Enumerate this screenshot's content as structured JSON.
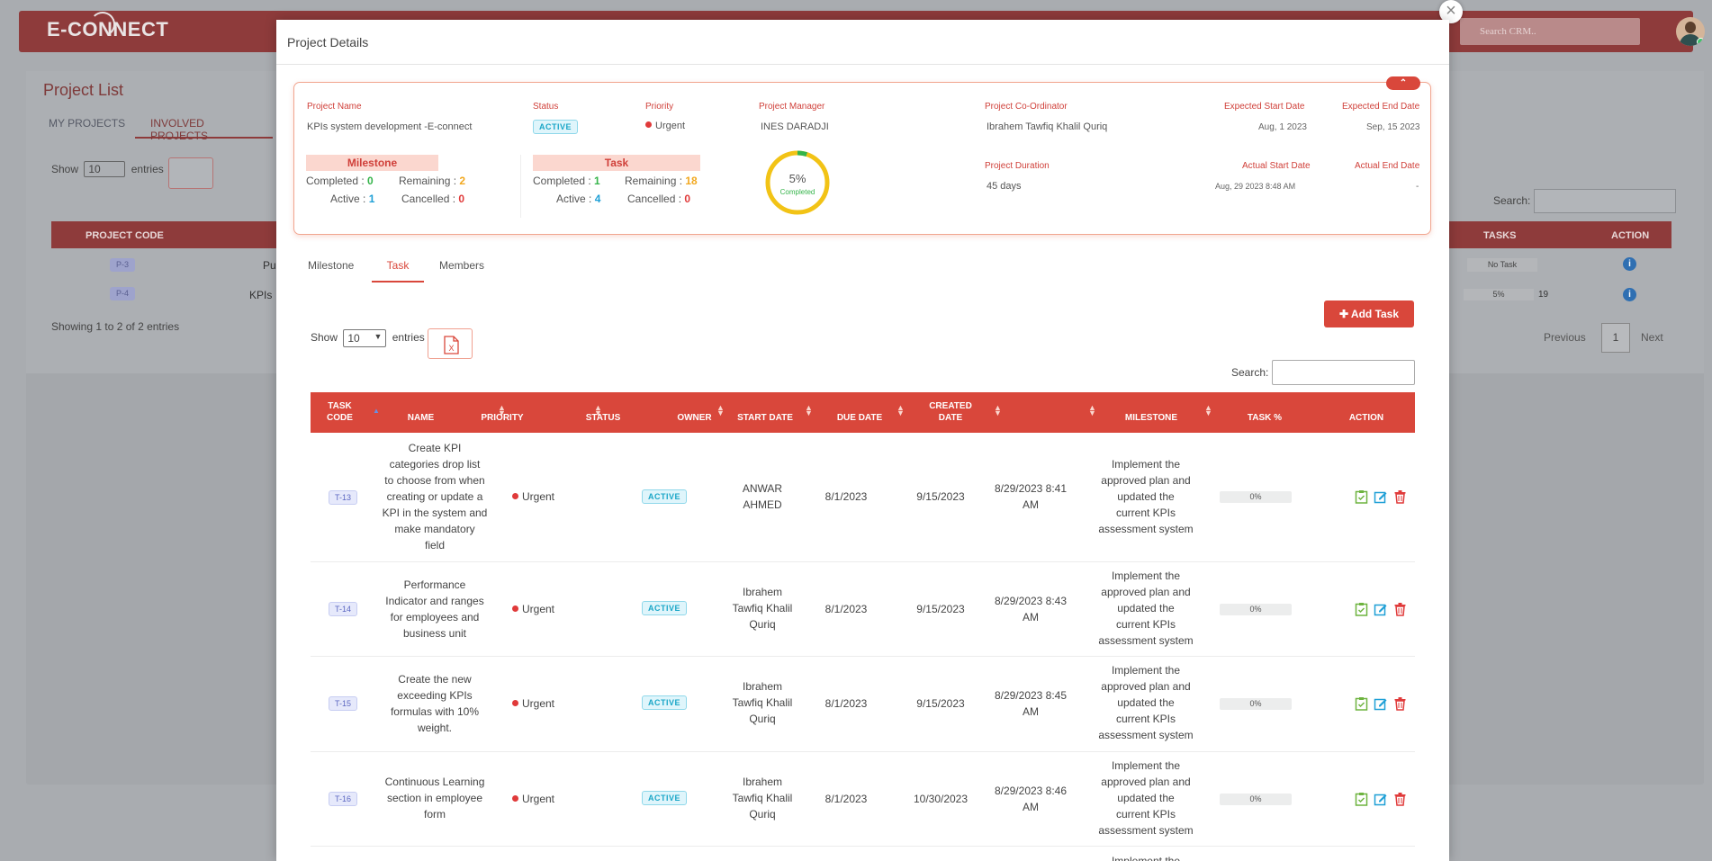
{
  "app": {
    "logo": "E-CONNECT",
    "search_placeholder": "Search CRM.."
  },
  "project_list": {
    "title": "Project List",
    "tabs": [
      "MY PROJECTS",
      "INVOLVED PROJECTS"
    ],
    "show_label": "Show",
    "entries_value": "10",
    "entries_label": "entries",
    "search_label": "Search:",
    "columns": [
      "PROJECT CODE",
      "TASKS",
      "ACTION"
    ],
    "rows": [
      {
        "code": "P-3",
        "name": "Pu",
        "tasks": "No Task"
      },
      {
        "code": "P-4",
        "name": "KPIs",
        "progress": "5%",
        "count": "19"
      }
    ],
    "showing": "Showing 1 to 2 of 2 entries",
    "pagination": {
      "previous": "Previous",
      "page": "1",
      "next": "Next"
    }
  },
  "modal": {
    "title": "Project Details",
    "close": "×",
    "summary": {
      "project_name_label": "Project Name",
      "project_name": "KPIs system development -E-connect",
      "status_label": "Status",
      "status": "ACTIVE",
      "priority_label": "Priority",
      "priority": "Urgent",
      "manager_label": "Project Manager",
      "manager": "INES DARADJI",
      "coordinator_label": "Project Co-Ordinator",
      "coordinator": "Ibrahem Tawfiq Khalil Quriq",
      "exp_start_label": "Expected Start Date",
      "exp_start": "Aug, 1 2023",
      "exp_end_label": "Expected End Date",
      "exp_end": "Sep, 15 2023",
      "duration_label": "Project Duration",
      "duration": "45 days",
      "act_start_label": "Actual Start Date",
      "act_start": "Aug, 29 2023 8:48 AM",
      "act_end_label": "Actual End Date",
      "act_end": "-",
      "milestone": {
        "title": "Milestone",
        "completed_label": "Completed :",
        "completed": "0",
        "remaining_label": "Remaining :",
        "remaining": "2",
        "active_label": "Active :",
        "active": "1",
        "cancelled_label": "Cancelled :",
        "cancelled": "0"
      },
      "task": {
        "title": "Task",
        "completed_label": "Completed :",
        "completed": "1",
        "remaining_label": "Remaining :",
        "remaining": "18",
        "active_label": "Active :",
        "active": "4",
        "cancelled_label": "Cancelled :",
        "cancelled": "0"
      },
      "progress_pct": "5%",
      "progress_value": 0.05,
      "progress_label": "Completed"
    },
    "tabs": [
      "Milestone",
      "Task",
      "Members"
    ],
    "active_tab": "Task",
    "add_task_label": "Add Task",
    "show_label": "Show",
    "entries_value": "10",
    "entries_label": "entries",
    "search_label": "Search:",
    "columns": {
      "task_code": [
        "TASK",
        "CODE"
      ],
      "name": "NAME",
      "priority": "PRIORITY",
      "status": "STATUS",
      "owner": "OWNER",
      "start_date": "START DATE",
      "due_date": "DUE DATE",
      "created_date": [
        "CREATED",
        "DATE"
      ],
      "milestone": "MILESTONE",
      "task_pct": "TASK %",
      "action": "ACTION"
    },
    "tasks": [
      {
        "code": "T-13",
        "name": [
          "Create KPI",
          "categories drop list",
          "to choose from when",
          "creating or update a",
          "KPI in the system and",
          "make mandatory",
          "field"
        ],
        "priority": "Urgent",
        "status": "ACTIVE",
        "owner": [
          "ANWAR",
          "AHMED"
        ],
        "start": "8/1/2023",
        "due": "9/15/2023",
        "created": [
          "8/29/2023 8:41",
          "AM"
        ],
        "milestone": [
          "Implement the",
          "approved plan and",
          "updated the",
          "current KPIs",
          "assessment system"
        ],
        "pct": "0%"
      },
      {
        "code": "T-14",
        "name": [
          "Performance",
          "Indicator and ranges",
          "for employees and",
          "business unit"
        ],
        "priority": "Urgent",
        "status": "ACTIVE",
        "owner": [
          "Ibrahem",
          "Tawfiq Khalil",
          "Quriq"
        ],
        "start": "8/1/2023",
        "due": "9/15/2023",
        "created": [
          "8/29/2023 8:43",
          "AM"
        ],
        "milestone": [
          "Implement the",
          "approved plan and",
          "updated the",
          "current KPIs",
          "assessment system"
        ],
        "pct": "0%"
      },
      {
        "code": "T-15",
        "name": [
          "Create the new",
          "exceeding KPIs",
          "formulas with 10%",
          "weight."
        ],
        "priority": "Urgent",
        "status": "ACTIVE",
        "owner": [
          "Ibrahem",
          "Tawfiq Khalil",
          "Quriq"
        ],
        "start": "8/1/2023",
        "due": "9/15/2023",
        "created": [
          "8/29/2023 8:45",
          "AM"
        ],
        "milestone": [
          "Implement the",
          "approved plan and",
          "updated the",
          "current KPIs",
          "assessment system"
        ],
        "pct": "0%"
      },
      {
        "code": "T-16",
        "name": [
          "Continuous Learning",
          "section in employee",
          "form"
        ],
        "priority": "Urgent",
        "status": "ACTIVE",
        "owner": [
          "Ibrahem",
          "Tawfiq Khalil",
          "Quriq"
        ],
        "start": "8/1/2023",
        "due": "10/30/2023",
        "created": [
          "8/29/2023 8:46",
          "AM"
        ],
        "milestone": [
          "Implement the",
          "approved plan and",
          "updated the",
          "current KPIs",
          "assessment system"
        ],
        "pct": "0%"
      }
    ],
    "partial_next_row": "Implement the"
  }
}
